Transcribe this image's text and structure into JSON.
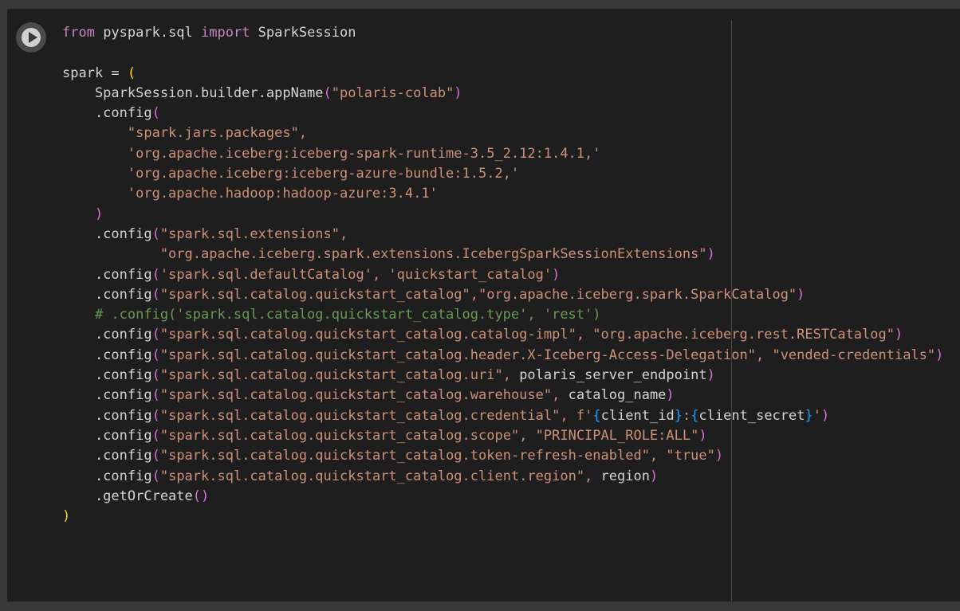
{
  "cell": {
    "run_button_icon": "play-icon",
    "lines": [
      [
        {
          "t": "from ",
          "c": "kw"
        },
        {
          "t": "pyspark.sql ",
          "c": "var"
        },
        {
          "t": "import ",
          "c": "kw"
        },
        {
          "t": "SparkSession",
          "c": "var"
        }
      ],
      [],
      [
        {
          "t": "spark = ",
          "c": "var"
        },
        {
          "t": "(",
          "c": "br"
        }
      ],
      [
        {
          "t": "    SparkSession.builder.appName",
          "c": "var"
        },
        {
          "t": "(",
          "c": "br2"
        },
        {
          "t": "\"polaris-colab\"",
          "c": "str"
        },
        {
          "t": ")",
          "c": "br2"
        }
      ],
      [
        {
          "t": "    .config",
          "c": "var"
        },
        {
          "t": "(",
          "c": "br2"
        }
      ],
      [
        {
          "t": "        \"spark.jars.packages\",",
          "c": "str"
        }
      ],
      [
        {
          "t": "        'org.apache.iceberg:iceberg-spark-runtime-3.5_2.12:1.4.1,'",
          "c": "str"
        }
      ],
      [
        {
          "t": "        'org.apache.iceberg:iceberg-azure-bundle:1.5.2,'",
          "c": "str"
        }
      ],
      [
        {
          "t": "        'org.apache.hadoop:hadoop-azure:3.4.1'",
          "c": "str"
        }
      ],
      [
        {
          "t": "    ",
          "c": "var"
        },
        {
          "t": ")",
          "c": "br2"
        }
      ],
      [
        {
          "t": "    .config",
          "c": "var"
        },
        {
          "t": "(",
          "c": "br2"
        },
        {
          "t": "\"spark.sql.extensions\",",
          "c": "str"
        }
      ],
      [
        {
          "t": "            \"org.apache.iceberg.spark.extensions.IcebergSparkSessionExtensions\"",
          "c": "str"
        },
        {
          "t": ")",
          "c": "br2"
        }
      ],
      [
        {
          "t": "    .config",
          "c": "var"
        },
        {
          "t": "(",
          "c": "br2"
        },
        {
          "t": "'spark.sql.defaultCatalog', 'quickstart_catalog'",
          "c": "str"
        },
        {
          "t": ")",
          "c": "br2"
        }
      ],
      [
        {
          "t": "    .config",
          "c": "var"
        },
        {
          "t": "(",
          "c": "br2"
        },
        {
          "t": "\"spark.sql.catalog.quickstart_catalog\",\"org.apache.iceberg.spark.SparkCatalog\"",
          "c": "str"
        },
        {
          "t": ")",
          "c": "br2"
        }
      ],
      [
        {
          "t": "    # .config('spark.sql.catalog.quickstart_catalog.type', 'rest')",
          "c": "cmt"
        }
      ],
      [
        {
          "t": "    .config",
          "c": "var"
        },
        {
          "t": "(",
          "c": "br2"
        },
        {
          "t": "\"spark.sql.catalog.quickstart_catalog.catalog-impl\", \"org.apache.iceberg.rest.RESTCatalog\"",
          "c": "str"
        },
        {
          "t": ")",
          "c": "br2"
        }
      ],
      [
        {
          "t": "    .config",
          "c": "var"
        },
        {
          "t": "(",
          "c": "br2"
        },
        {
          "t": "\"spark.sql.catalog.quickstart_catalog.header.X-Iceberg-Access-Delegation\", \"vended-credentials\"",
          "c": "str"
        },
        {
          "t": ")",
          "c": "br2"
        }
      ],
      [
        {
          "t": "    .config",
          "c": "var"
        },
        {
          "t": "(",
          "c": "br2"
        },
        {
          "t": "\"spark.sql.catalog.quickstart_catalog.uri\", ",
          "c": "str"
        },
        {
          "t": "polaris_server_endpoint",
          "c": "var"
        },
        {
          "t": ")",
          "c": "br2"
        }
      ],
      [
        {
          "t": "    .config",
          "c": "var"
        },
        {
          "t": "(",
          "c": "br2"
        },
        {
          "t": "\"spark.sql.catalog.quickstart_catalog.warehouse\", ",
          "c": "str"
        },
        {
          "t": "catalog_name",
          "c": "var"
        },
        {
          "t": ")",
          "c": "br2"
        }
      ],
      [
        {
          "t": "    .config",
          "c": "var"
        },
        {
          "t": "(",
          "c": "br2"
        },
        {
          "t": "\"spark.sql.catalog.quickstart_catalog.credential\", ",
          "c": "str"
        },
        {
          "t": "f'",
          "c": "str"
        },
        {
          "t": "{",
          "c": "br3"
        },
        {
          "t": "client_id",
          "c": "var"
        },
        {
          "t": "}",
          "c": "br3"
        },
        {
          "t": ":",
          "c": "str"
        },
        {
          "t": "{",
          "c": "br3"
        },
        {
          "t": "client_secret",
          "c": "var"
        },
        {
          "t": "}",
          "c": "br3"
        },
        {
          "t": "'",
          "c": "str"
        },
        {
          "t": ")",
          "c": "br2"
        }
      ],
      [
        {
          "t": "    .config",
          "c": "var"
        },
        {
          "t": "(",
          "c": "br2"
        },
        {
          "t": "\"spark.sql.catalog.quickstart_catalog.scope\", \"PRINCIPAL_ROLE:ALL\"",
          "c": "str"
        },
        {
          "t": ")",
          "c": "br2"
        }
      ],
      [
        {
          "t": "    .config",
          "c": "var"
        },
        {
          "t": "(",
          "c": "br2"
        },
        {
          "t": "\"spark.sql.catalog.quickstart_catalog.token-refresh-enabled\", \"true\"",
          "c": "str"
        },
        {
          "t": ")",
          "c": "br2"
        }
      ],
      [
        {
          "t": "    .config",
          "c": "var"
        },
        {
          "t": "(",
          "c": "br2"
        },
        {
          "t": "\"spark.sql.catalog.quickstart_catalog.client.region\", ",
          "c": "str"
        },
        {
          "t": "region",
          "c": "var"
        },
        {
          "t": ")",
          "c": "br2"
        }
      ],
      [
        {
          "t": "    .getOrCreate",
          "c": "var"
        },
        {
          "t": "()",
          "c": "br2"
        }
      ],
      [
        {
          "t": ")",
          "c": "br"
        }
      ]
    ]
  }
}
